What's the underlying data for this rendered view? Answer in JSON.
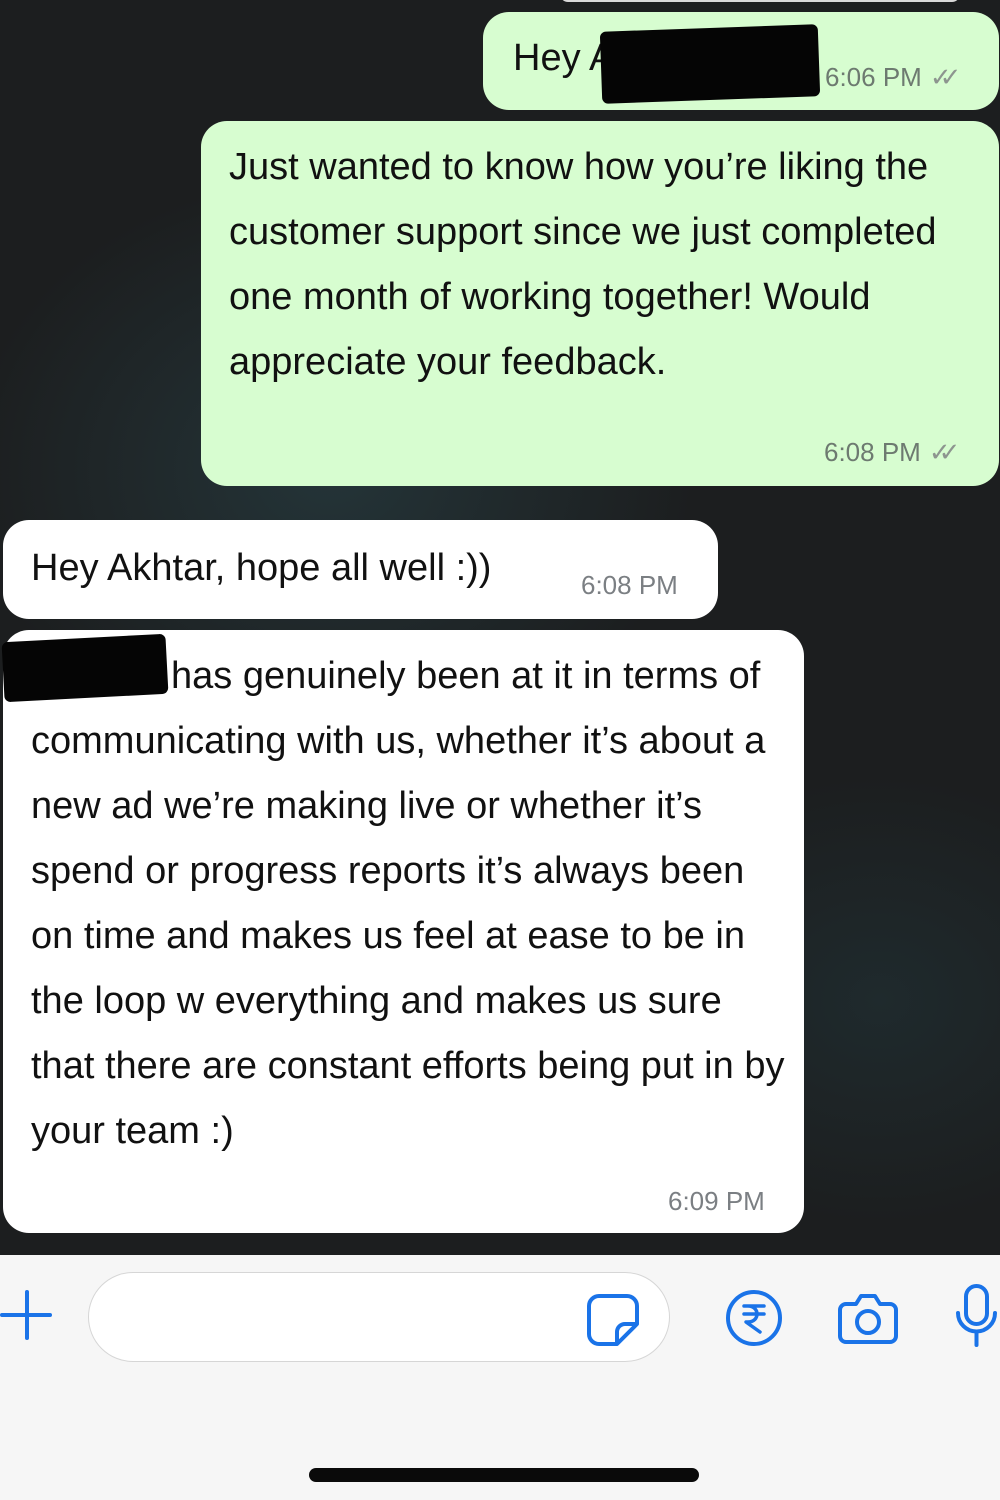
{
  "messages": [
    {
      "direction": "outgoing",
      "text": "Hey A",
      "time": "6:06 PM",
      "status": "read",
      "redacted": true
    },
    {
      "direction": "outgoing",
      "text": "Just wanted to know how you’re liking the customer support since we just completed one month of working together! Would appreciate your feedback.",
      "time": "6:08 PM",
      "status": "read"
    },
    {
      "direction": "incoming",
      "text": "Hey Akhtar, hope all well :))",
      "time": "6:08 PM"
    },
    {
      "direction": "incoming",
      "text": "has genuinely been at it in terms of communicating with us, whether it’s about a new ad we’re making live or whether it’s spend or progress reports it’s always been on time and makes us feel at ease to be in the loop w everything and makes us sure that there are constant efforts being put in by your team :)",
      "time": "6:09 PM",
      "redacted": true
    }
  ],
  "status_ticks": "✓✓",
  "input": {
    "placeholder": "",
    "icons": [
      "plus-icon",
      "sticker-icon",
      "rupee-payment-icon",
      "camera-icon",
      "microphone-icon"
    ]
  },
  "colors": {
    "outgoing_bubble": "#d7fdd0",
    "incoming_bubble": "#ffffff",
    "accent_blue": "#1a73e8",
    "chat_background": "#1c1e1f"
  }
}
